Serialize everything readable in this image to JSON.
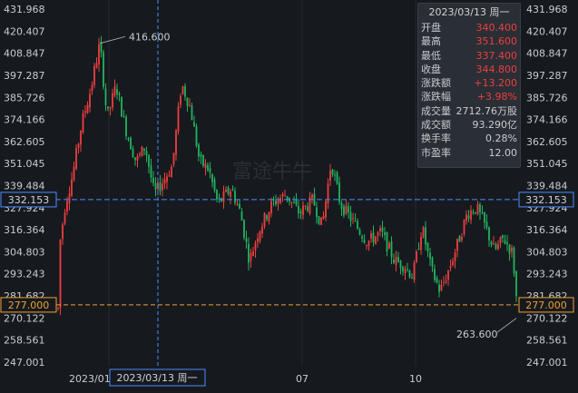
{
  "chart_data": {
    "type": "candlestick",
    "y_ticks": [
      "431.968",
      "420.407",
      "408.847",
      "397.287",
      "385.726",
      "374.166",
      "362.605",
      "351.045",
      "339.484",
      "327.924",
      "316.364",
      "304.803",
      "293.243",
      "281.682",
      "270.122",
      "258.561",
      "247.001"
    ],
    "ylim": [
      247.001,
      431.968
    ],
    "x_ticks": [
      "2023/01",
      "07",
      "10"
    ],
    "max_marker": "416.600",
    "min_marker": "263.600",
    "crosshair_price": "332.153",
    "last_price": "277.000",
    "crosshair_date": "2023/03/13 周一",
    "watermark": "富途牛牛"
  },
  "info": {
    "date": "2023/03/13 周一",
    "rows": [
      {
        "label": "开盘",
        "value": "340.400",
        "color": "red"
      },
      {
        "label": "最高",
        "value": "351.600",
        "color": "red"
      },
      {
        "label": "最低",
        "value": "337.400",
        "color": "red"
      },
      {
        "label": "收盘",
        "value": "344.800",
        "color": "red"
      },
      {
        "label": "涨跌额",
        "value": "+13.200",
        "color": "red"
      },
      {
        "label": "涨跌幅",
        "value": "+3.98%",
        "color": "red"
      },
      {
        "label": "成交量",
        "value": "2712.76万股",
        "color": "none"
      },
      {
        "label": "成交额",
        "value": "93.290亿",
        "color": "none"
      },
      {
        "label": "换手率",
        "value": "0.28%",
        "color": "none"
      },
      {
        "label": "市盈率",
        "value": "12.00",
        "color": "none"
      }
    ]
  },
  "colors": {
    "up": "#ef3e3e",
    "down": "#21b45d",
    "crosshair_tag": "#4a8cff",
    "last_price_tag": "#f0a030"
  }
}
